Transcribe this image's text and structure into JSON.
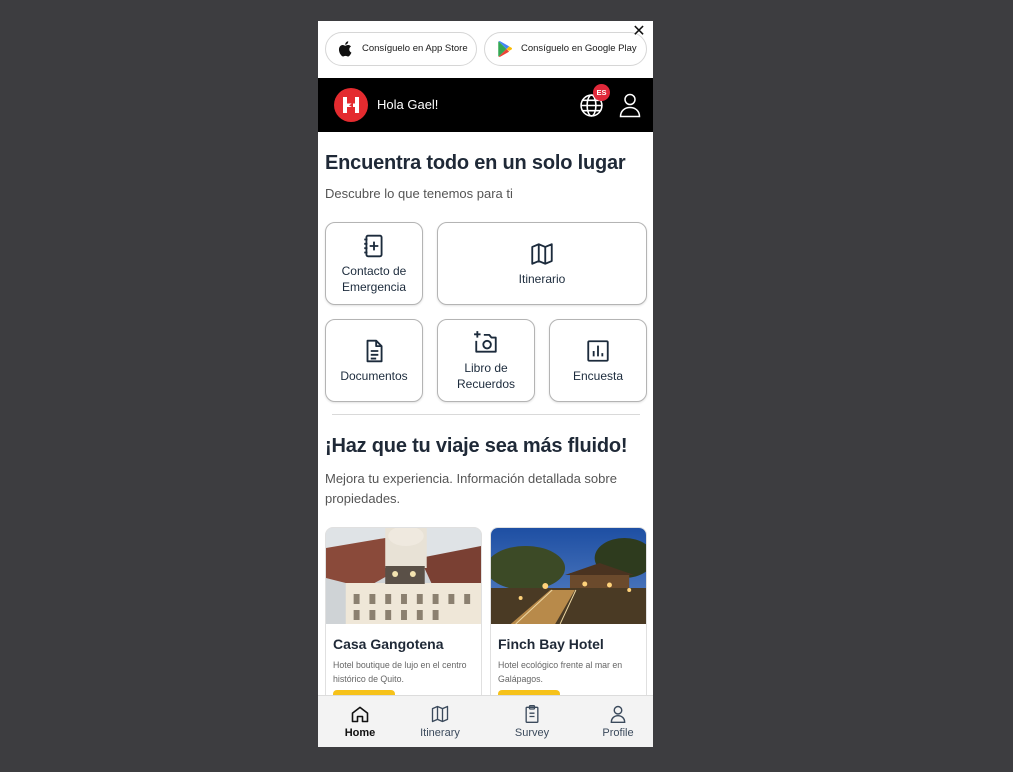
{
  "banner": {
    "app_store_label": "Consíguelo en App Store",
    "google_play_label": "Consíguelo en Google Play",
    "close_glyph": "✕"
  },
  "header": {
    "greeting": "Hola Gael!",
    "language_badge": "ES",
    "brand_color": "#e42b2f"
  },
  "section1": {
    "title": "Encuentra todo en un solo lugar",
    "subtitle": "Descubre lo que tenemos para ti",
    "tiles": [
      {
        "label": "Contacto de Emergencia",
        "icon": "emergency-contact-icon"
      },
      {
        "label": "Itinerario",
        "icon": "map-icon"
      },
      {
        "label": "Documentos",
        "icon": "document-icon"
      },
      {
        "label": "Libro de Recuerdos",
        "icon": "add-photo-icon"
      },
      {
        "label": "Encuesta",
        "icon": "bar-chart-icon"
      }
    ]
  },
  "section2": {
    "title": "¡Haz que tu viaje sea más fluido!",
    "subtitle": "Mejora tu experiencia. Información detallada sobre propiedades.",
    "cards": [
      {
        "title": "Casa Gangotena",
        "description": "Hotel boutique de lujo en el centro histórico de Quito."
      },
      {
        "title": "Finch Bay Hotel",
        "description": "Hotel ecológico frente al mar en Galápagos."
      }
    ]
  },
  "bottom_nav": {
    "items": [
      {
        "label": "Home",
        "icon": "home-icon",
        "active": true
      },
      {
        "label": "Itinerary",
        "icon": "map-icon",
        "active": false
      },
      {
        "label": "Survey",
        "icon": "clipboard-icon",
        "active": false
      },
      {
        "label": "Profile",
        "icon": "user-icon",
        "active": false
      }
    ]
  },
  "colors": {
    "page_background": "#3d3d40",
    "header_background": "#000000",
    "accent_yellow": "#f6c21a",
    "badge_red": "#e0283a"
  }
}
